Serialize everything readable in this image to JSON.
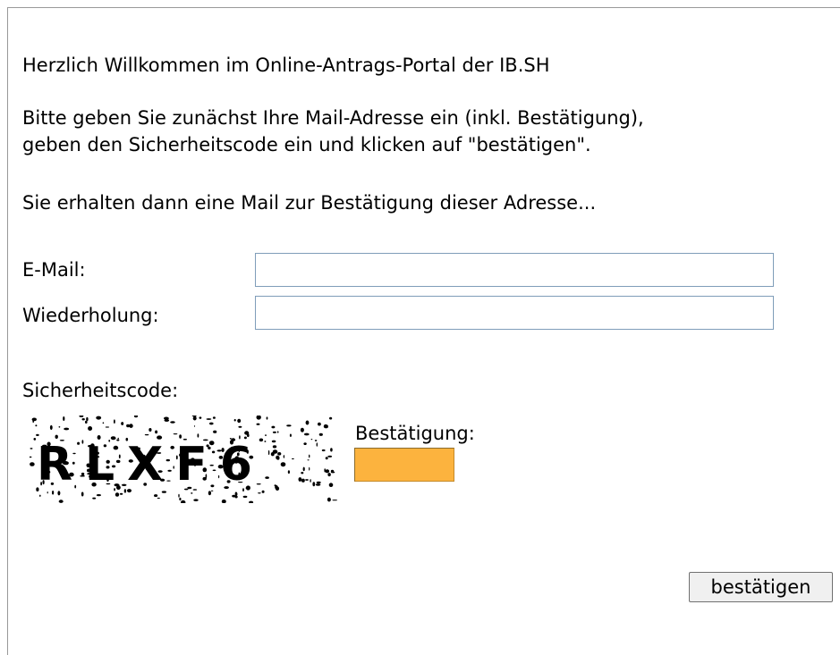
{
  "welcome": "Herzlich Willkommen im Online-Antrags-Portal der IB.SH",
  "instructions": {
    "line1": "Bitte geben Sie zunächst Ihre Mail-Adresse ein (inkl. Bestätigung),",
    "line2": "geben den Sicherheitscode ein und klicken auf \"bestätigen\"."
  },
  "info": "Sie erhalten dann eine Mail zur Bestätigung dieser Adresse...",
  "form": {
    "email_label": "E-Mail:",
    "email_value": "",
    "repeat_label": "Wiederholung:",
    "repeat_value": "",
    "security_label": "Sicherheitscode:",
    "captcha_text": "RLXF6",
    "confirm_label": "Bestätigung:",
    "confirm_value": "",
    "confirm_field_color": "#fcb33e",
    "submit_label": "bestätigen"
  }
}
